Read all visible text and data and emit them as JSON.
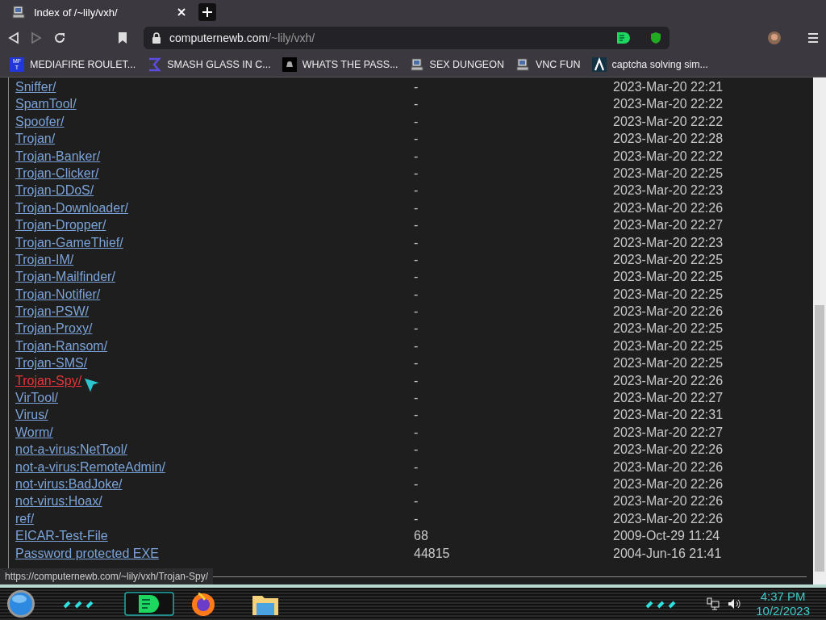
{
  "tab": {
    "title": "Index of /~lily/vxh/",
    "selected": true
  },
  "address": {
    "domain": "computernewb.com",
    "path": "/~lily/vxh/"
  },
  "bookmarks": [
    {
      "label": "MEDIAFIRE ROULET...",
      "kind": "badge",
      "badge_lines": [
        "MF",
        "T"
      ]
    },
    {
      "label": "SMASH GLASS IN C...",
      "kind": "sigma"
    },
    {
      "label": "WHATS THE PASS...",
      "kind": "dark"
    },
    {
      "label": "SEX DUNGEON",
      "kind": "computer"
    },
    {
      "label": "VNC FUN",
      "kind": "computer"
    },
    {
      "label": "captcha solving sim...",
      "kind": "lambda"
    }
  ],
  "listing": {
    "rows": [
      {
        "name": "Sniffer/",
        "size": "-",
        "date": "2023-Mar-20 22:21",
        "hovered": false
      },
      {
        "name": "SpamTool/",
        "size": "-",
        "date": "2023-Mar-20 22:22",
        "hovered": false
      },
      {
        "name": "Spoofer/",
        "size": "-",
        "date": "2023-Mar-20 22:22",
        "hovered": false
      },
      {
        "name": "Trojan/",
        "size": "-",
        "date": "2023-Mar-20 22:28",
        "hovered": false
      },
      {
        "name": "Trojan-Banker/",
        "size": "-",
        "date": "2023-Mar-20 22:22",
        "hovered": false
      },
      {
        "name": "Trojan-Clicker/",
        "size": "-",
        "date": "2023-Mar-20 22:25",
        "hovered": false
      },
      {
        "name": "Trojan-DDoS/",
        "size": "-",
        "date": "2023-Mar-20 22:23",
        "hovered": false
      },
      {
        "name": "Trojan-Downloader/",
        "size": "-",
        "date": "2023-Mar-20 22:26",
        "hovered": false
      },
      {
        "name": "Trojan-Dropper/",
        "size": "-",
        "date": "2023-Mar-20 22:27",
        "hovered": false
      },
      {
        "name": "Trojan-GameThief/",
        "size": "-",
        "date": "2023-Mar-20 22:23",
        "hovered": false
      },
      {
        "name": "Trojan-IM/",
        "size": "-",
        "date": "2023-Mar-20 22:25",
        "hovered": false
      },
      {
        "name": "Trojan-Mailfinder/",
        "size": "-",
        "date": "2023-Mar-20 22:25",
        "hovered": false
      },
      {
        "name": "Trojan-Notifier/",
        "size": "-",
        "date": "2023-Mar-20 22:25",
        "hovered": false
      },
      {
        "name": "Trojan-PSW/",
        "size": "-",
        "date": "2023-Mar-20 22:26",
        "hovered": false
      },
      {
        "name": "Trojan-Proxy/",
        "size": "-",
        "date": "2023-Mar-20 22:25",
        "hovered": false
      },
      {
        "name": "Trojan-Ransom/",
        "size": "-",
        "date": "2023-Mar-20 22:25",
        "hovered": false
      },
      {
        "name": "Trojan-SMS/",
        "size": "-",
        "date": "2023-Mar-20 22:25",
        "hovered": false
      },
      {
        "name": "Trojan-Spy/",
        "size": "-",
        "date": "2023-Mar-20 22:26",
        "hovered": true
      },
      {
        "name": "VirTool/",
        "size": "-",
        "date": "2023-Mar-20 22:27",
        "hovered": false
      },
      {
        "name": "Virus/",
        "size": "-",
        "date": "2023-Mar-20 22:31",
        "hovered": false
      },
      {
        "name": "Worm/",
        "size": "-",
        "date": "2023-Mar-20 22:27",
        "hovered": false
      },
      {
        "name": "not-a-virus:NetTool/",
        "size": "-",
        "date": "2023-Mar-20 22:26",
        "hovered": false
      },
      {
        "name": "not-a-virus:RemoteAdmin/",
        "size": "-",
        "date": "2023-Mar-20 22:26",
        "hovered": false
      },
      {
        "name": "not-virus:BadJoke/",
        "size": "-",
        "date": "2023-Mar-20 22:26",
        "hovered": false
      },
      {
        "name": "not-virus:Hoax/",
        "size": "-",
        "date": "2023-Mar-20 22:26",
        "hovered": false
      },
      {
        "name": "ref/",
        "size": "-",
        "date": "2023-Mar-20 22:26",
        "hovered": false
      },
      {
        "name": "EICAR-Test-File",
        "size": "68",
        "date": "2009-Oct-29 11:24",
        "hovered": false
      },
      {
        "name": "Password protected EXE",
        "size": "44815",
        "date": "2004-Jun-16 21:41",
        "hovered": false
      }
    ]
  },
  "status_url": "https://computernewb.com/~lily/vxh/Trojan-Spy/",
  "clock": {
    "time": "4:37 PM",
    "date": "10/2/2023"
  }
}
